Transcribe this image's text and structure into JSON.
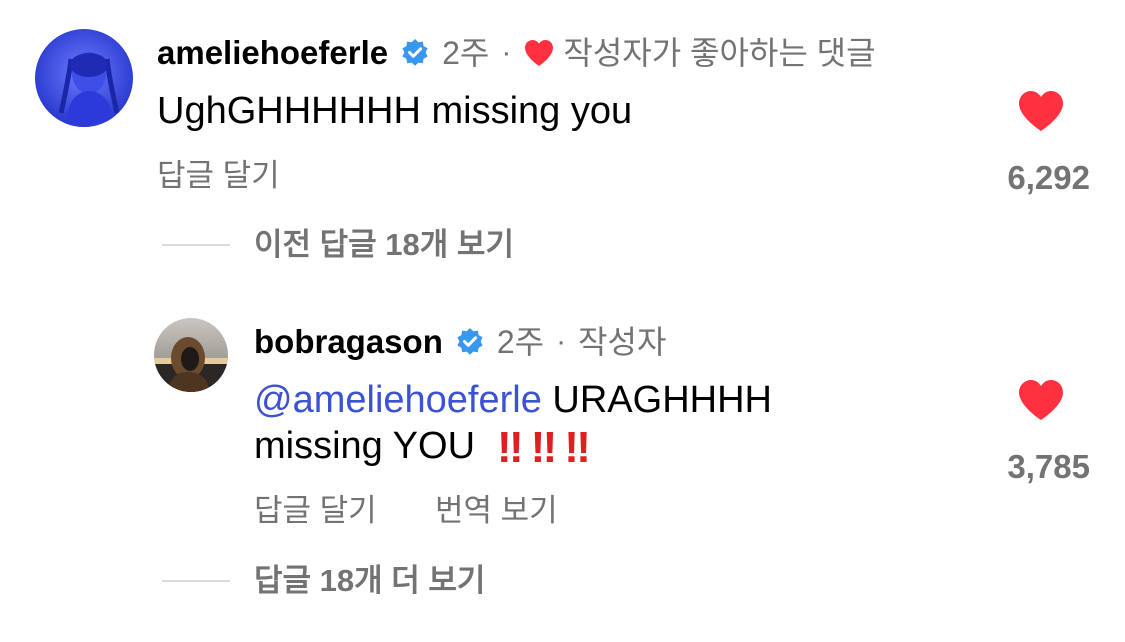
{
  "colors": {
    "text": "#000000",
    "secondary_text": "#737373",
    "verified_blue": "#3897f0",
    "like_red": "#ff3040",
    "mention_blue": "#3b51d6",
    "emoji_red": "#e02020",
    "thread_line": "#dbdbdb"
  },
  "comments": [
    {
      "username": "ameliehoeferle",
      "verified": true,
      "verified_icon": "verified-badge-icon",
      "time": "2주",
      "separator": "·",
      "creator_liked_icon": "heart-icon",
      "creator_liked_label": "작성자가 좋아하는 댓글",
      "text": "UghGHHHHHH missing you",
      "reply_label": "답글 달기",
      "like_icon": "heart-icon",
      "like_count": "6,292"
    },
    {
      "username": "bobragason",
      "verified": true,
      "verified_icon": "verified-badge-icon",
      "time": "2주",
      "separator": "·",
      "author_label": "작성자",
      "mention": "@ameliehoeferle",
      "text_line1": " URAGHHHH",
      "text_line2": "missing YOU",
      "emojis": [
        "‼",
        "‼",
        "‼"
      ],
      "reply_label": "답글 달기",
      "translate_label": "번역 보기",
      "like_icon": "heart-icon",
      "like_count": "3,785"
    }
  ],
  "threads": {
    "previous_replies_label": "이전 답글 18개 보기",
    "more_replies_label": "답글 18개 더 보기"
  }
}
